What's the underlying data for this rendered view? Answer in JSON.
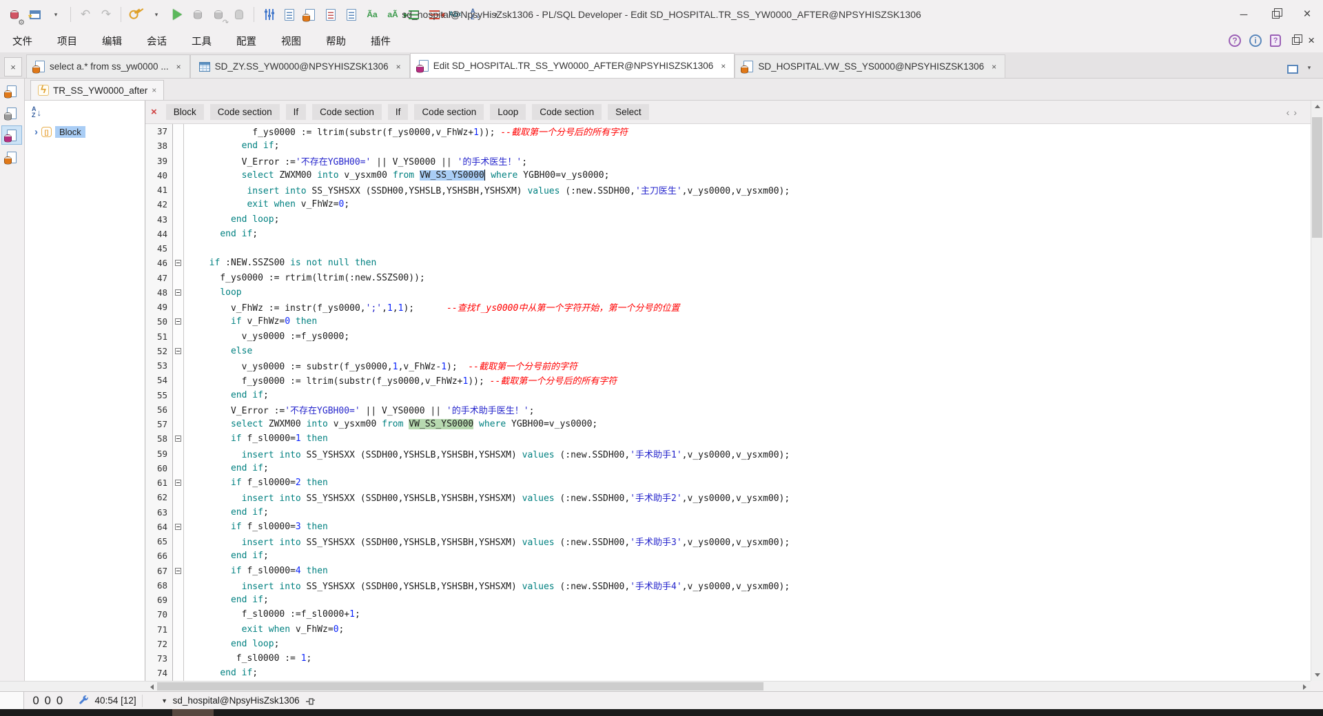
{
  "title_bar": {
    "title": "sd_hospital@NpsyHisZsk1306 - PL/SQL Developer - Edit SD_HOSPITAL.TR_SS_YW0000_AFTER@NPSYHISZSK1306"
  },
  "toolbar": {
    "icons": [
      "db-gear",
      "new-window",
      "caret",
      "sep",
      "undo",
      "redo",
      "sep",
      "key",
      "caret",
      "run",
      "commit",
      "rollback",
      "break",
      "sep",
      "preferences",
      "report-doc",
      "sql-doc",
      "doc-red",
      "doc-blue",
      "lowercase",
      "uppercase",
      "indent",
      "unindent",
      "special-chars",
      "sort-az",
      "caret"
    ]
  },
  "menu_bar": {
    "items": [
      "文件",
      "项目",
      "编辑",
      "会话",
      "工具",
      "配置",
      "视图",
      "帮助",
      "插件"
    ]
  },
  "tab_bar": {
    "tabs": [
      {
        "label": "select a.* from ss_yw0000 ...",
        "icon": "sql-doc-orange",
        "active": false
      },
      {
        "label": "SD_ZY.SS_YW0000@NPSYHISZSK1306",
        "icon": "table",
        "active": false
      },
      {
        "label": "Edit SD_HOSPITAL.TR_SS_YW0000_AFTER@NPSYHISZSK1306",
        "icon": "doc-magenta",
        "active": true
      },
      {
        "label": "SD_HOSPITAL.VW_SS_YS0000@NPSYHISZSK1306",
        "icon": "sql-doc-orange",
        "active": false
      }
    ]
  },
  "left_strip": {
    "icons": [
      {
        "name": "sql-window-icon",
        "color": "orange",
        "selected": false
      },
      {
        "name": "command-window-icon",
        "color": "gray",
        "selected": false
      },
      {
        "name": "trigger-window-icon",
        "color": "magenta",
        "selected": true
      },
      {
        "name": "view-window-icon",
        "color": "orange",
        "selected": false
      }
    ]
  },
  "sub_tab": {
    "label": "TR_SS_YW0000_after"
  },
  "breadcrumb": {
    "items": [
      "Block",
      "Code section",
      "If",
      "Code section",
      "If",
      "Code section",
      "Loop",
      "Code section",
      "Select"
    ]
  },
  "tree": {
    "root_label": "Block"
  },
  "colors": {
    "keyword": "#008080",
    "string": "#2626cc",
    "number": "#0b24fb",
    "comment": "#ff0000",
    "selection_blue": "#a9cdf5",
    "selection_green": "#b7d9b0"
  },
  "editor": {
    "lines": [
      {
        "n": 37,
        "f": 0,
        "s": [
          [
            "p",
            "          f_ys0000 := ltrim(substr(f_ys0000,v_FhWz+"
          ],
          [
            "n",
            "1"
          ],
          [
            "p",
            ")); "
          ],
          [
            "c",
            "--截取第一个分号后的所有字符"
          ]
        ]
      },
      {
        "n": 38,
        "f": 0,
        "s": [
          [
            "p",
            "        "
          ],
          [
            "k",
            "end if"
          ],
          [
            "p",
            ";"
          ]
        ]
      },
      {
        "n": 39,
        "f": 0,
        "s": [
          [
            "p",
            "        V_Error :="
          ],
          [
            "s",
            "'不存在YGBH00='"
          ],
          [
            "p",
            " || V_YS0000 || "
          ],
          [
            "s",
            "'的手术医生！'"
          ],
          [
            "p",
            ";"
          ]
        ]
      },
      {
        "n": 40,
        "f": 0,
        "s": [
          [
            "p",
            "        "
          ],
          [
            "k",
            "select"
          ],
          [
            "p",
            " ZWXM00 "
          ],
          [
            "k",
            "into"
          ],
          [
            "p",
            " v_ysxm00 "
          ],
          [
            "k",
            "from"
          ],
          [
            "p",
            " "
          ],
          [
            "sb",
            "VW_SS_YS0000"
          ],
          [
            "cur",
            ""
          ],
          [
            "p",
            " "
          ],
          [
            "k",
            "where"
          ],
          [
            "p",
            " YGBH00=v_ys0000;"
          ]
        ]
      },
      {
        "n": 41,
        "f": 0,
        "s": [
          [
            "p",
            "         "
          ],
          [
            "k",
            "insert"
          ],
          [
            "p",
            " "
          ],
          [
            "k",
            "into"
          ],
          [
            "p",
            " SS_YSHSXX (SSDH00,YSHSLB,YSHSBH,YSHSXM) "
          ],
          [
            "k",
            "values"
          ],
          [
            "p",
            " (:new.SSDH00,"
          ],
          [
            "s",
            "'主刀医生'"
          ],
          [
            "p",
            ",v_ys0000,v_ysxm00);"
          ]
        ]
      },
      {
        "n": 42,
        "f": 0,
        "s": [
          [
            "p",
            "         "
          ],
          [
            "k",
            "exit"
          ],
          [
            "p",
            " "
          ],
          [
            "k",
            "when"
          ],
          [
            "p",
            " v_FhWz="
          ],
          [
            "n",
            "0"
          ],
          [
            "p",
            ";"
          ]
        ]
      },
      {
        "n": 43,
        "f": 0,
        "s": [
          [
            "p",
            "      "
          ],
          [
            "k",
            "end loop"
          ],
          [
            "p",
            ";"
          ]
        ]
      },
      {
        "n": 44,
        "f": 0,
        "s": [
          [
            "p",
            "    "
          ],
          [
            "k",
            "end if"
          ],
          [
            "p",
            ";"
          ]
        ]
      },
      {
        "n": 45,
        "f": 0,
        "s": []
      },
      {
        "n": 46,
        "f": 1,
        "s": [
          [
            "p",
            "  "
          ],
          [
            "k",
            "if"
          ],
          [
            "p",
            " :NEW.SSZS00 "
          ],
          [
            "k",
            "is not null then"
          ]
        ]
      },
      {
        "n": 47,
        "f": 0,
        "s": [
          [
            "p",
            "    f_ys0000 := rtrim(ltrim(:new.SSZS00));"
          ]
        ]
      },
      {
        "n": 48,
        "f": 1,
        "s": [
          [
            "p",
            "    "
          ],
          [
            "k",
            "loop"
          ]
        ]
      },
      {
        "n": 49,
        "f": 0,
        "s": [
          [
            "p",
            "      v_FhWz := instr(f_ys0000,"
          ],
          [
            "s",
            "';'"
          ],
          [
            "p",
            ","
          ],
          [
            "n",
            "1"
          ],
          [
            "p",
            ","
          ],
          [
            "n",
            "1"
          ],
          [
            "p",
            ");      "
          ],
          [
            "c",
            "--查找f_ys0000中从第一个字符开始，第一个分号的位置"
          ]
        ]
      },
      {
        "n": 50,
        "f": 1,
        "s": [
          [
            "p",
            "      "
          ],
          [
            "k",
            "if"
          ],
          [
            "p",
            " v_FhWz="
          ],
          [
            "n",
            "0"
          ],
          [
            "p",
            " "
          ],
          [
            "k",
            "then"
          ]
        ]
      },
      {
        "n": 51,
        "f": 0,
        "s": [
          [
            "p",
            "        v_ys0000 :=f_ys0000;"
          ]
        ]
      },
      {
        "n": 52,
        "f": 1,
        "s": [
          [
            "p",
            "      "
          ],
          [
            "k",
            "else"
          ]
        ]
      },
      {
        "n": 53,
        "f": 0,
        "s": [
          [
            "p",
            "        v_ys0000 := substr(f_ys0000,"
          ],
          [
            "n",
            "1"
          ],
          [
            "p",
            ",v_FhWz-"
          ],
          [
            "n",
            "1"
          ],
          [
            "p",
            ");  "
          ],
          [
            "c",
            "--截取第一个分号前的字符"
          ]
        ]
      },
      {
        "n": 54,
        "f": 0,
        "s": [
          [
            "p",
            "        f_ys0000 := ltrim(substr(f_ys0000,v_FhWz+"
          ],
          [
            "n",
            "1"
          ],
          [
            "p",
            ")); "
          ],
          [
            "c",
            "--截取第一个分号后的所有字符"
          ]
        ]
      },
      {
        "n": 55,
        "f": 0,
        "s": [
          [
            "p",
            "      "
          ],
          [
            "k",
            "end if"
          ],
          [
            "p",
            ";"
          ]
        ]
      },
      {
        "n": 56,
        "f": 0,
        "s": [
          [
            "p",
            "      V_Error :="
          ],
          [
            "s",
            "'不存在YGBH00='"
          ],
          [
            "p",
            " || V_YS0000 || "
          ],
          [
            "s",
            "'的手术助手医生！'"
          ],
          [
            "p",
            ";"
          ]
        ]
      },
      {
        "n": 57,
        "f": 0,
        "s": [
          [
            "p",
            "      "
          ],
          [
            "k",
            "select"
          ],
          [
            "p",
            " ZWXM00 "
          ],
          [
            "k",
            "into"
          ],
          [
            "p",
            " v_ysxm00 "
          ],
          [
            "k",
            "from"
          ],
          [
            "p",
            " "
          ],
          [
            "sg",
            "VW_SS_YS0000"
          ],
          [
            "p",
            " "
          ],
          [
            "k",
            "where"
          ],
          [
            "p",
            " YGBH00=v_ys0000;"
          ]
        ]
      },
      {
        "n": 58,
        "f": 1,
        "s": [
          [
            "p",
            "      "
          ],
          [
            "k",
            "if"
          ],
          [
            "p",
            " f_sl0000="
          ],
          [
            "n",
            "1"
          ],
          [
            "p",
            " "
          ],
          [
            "k",
            "then"
          ]
        ]
      },
      {
        "n": 59,
        "f": 0,
        "s": [
          [
            "p",
            "        "
          ],
          [
            "k",
            "insert"
          ],
          [
            "p",
            " "
          ],
          [
            "k",
            "into"
          ],
          [
            "p",
            " SS_YSHSXX (SSDH00,YSHSLB,YSHSBH,YSHSXM) "
          ],
          [
            "k",
            "values"
          ],
          [
            "p",
            " (:new.SSDH00,"
          ],
          [
            "s",
            "'手术助手1'"
          ],
          [
            "p",
            ",v_ys0000,v_ysxm00);"
          ]
        ]
      },
      {
        "n": 60,
        "f": 0,
        "s": [
          [
            "p",
            "      "
          ],
          [
            "k",
            "end if"
          ],
          [
            "p",
            ";"
          ]
        ]
      },
      {
        "n": 61,
        "f": 1,
        "s": [
          [
            "p",
            "      "
          ],
          [
            "k",
            "if"
          ],
          [
            "p",
            " f_sl0000="
          ],
          [
            "n",
            "2"
          ],
          [
            "p",
            " "
          ],
          [
            "k",
            "then"
          ]
        ]
      },
      {
        "n": 62,
        "f": 0,
        "s": [
          [
            "p",
            "        "
          ],
          [
            "k",
            "insert"
          ],
          [
            "p",
            " "
          ],
          [
            "k",
            "into"
          ],
          [
            "p",
            " SS_YSHSXX (SSDH00,YSHSLB,YSHSBH,YSHSXM) "
          ],
          [
            "k",
            "values"
          ],
          [
            "p",
            " (:new.SSDH00,"
          ],
          [
            "s",
            "'手术助手2'"
          ],
          [
            "p",
            ",v_ys0000,v_ysxm00);"
          ]
        ]
      },
      {
        "n": 63,
        "f": 0,
        "s": [
          [
            "p",
            "      "
          ],
          [
            "k",
            "end if"
          ],
          [
            "p",
            ";"
          ]
        ]
      },
      {
        "n": 64,
        "f": 1,
        "s": [
          [
            "p",
            "      "
          ],
          [
            "k",
            "if"
          ],
          [
            "p",
            " f_sl0000="
          ],
          [
            "n",
            "3"
          ],
          [
            "p",
            " "
          ],
          [
            "k",
            "then"
          ]
        ]
      },
      {
        "n": 65,
        "f": 0,
        "s": [
          [
            "p",
            "        "
          ],
          [
            "k",
            "insert"
          ],
          [
            "p",
            " "
          ],
          [
            "k",
            "into"
          ],
          [
            "p",
            " SS_YSHSXX (SSDH00,YSHSLB,YSHSBH,YSHSXM) "
          ],
          [
            "k",
            "values"
          ],
          [
            "p",
            " (:new.SSDH00,"
          ],
          [
            "s",
            "'手术助手3'"
          ],
          [
            "p",
            ",v_ys0000,v_ysxm00);"
          ]
        ]
      },
      {
        "n": 66,
        "f": 0,
        "s": [
          [
            "p",
            "      "
          ],
          [
            "k",
            "end if"
          ],
          [
            "p",
            ";"
          ]
        ]
      },
      {
        "n": 67,
        "f": 1,
        "s": [
          [
            "p",
            "      "
          ],
          [
            "k",
            "if"
          ],
          [
            "p",
            " f_sl0000="
          ],
          [
            "n",
            "4"
          ],
          [
            "p",
            " "
          ],
          [
            "k",
            "then"
          ]
        ]
      },
      {
        "n": 68,
        "f": 0,
        "s": [
          [
            "p",
            "        "
          ],
          [
            "k",
            "insert"
          ],
          [
            "p",
            " "
          ],
          [
            "k",
            "into"
          ],
          [
            "p",
            " SS_YSHSXX (SSDH00,YSHSLB,YSHSBH,YSHSXM) "
          ],
          [
            "k",
            "values"
          ],
          [
            "p",
            " (:new.SSDH00,"
          ],
          [
            "s",
            "'手术助手4'"
          ],
          [
            "p",
            ",v_ys0000,v_ysxm00);"
          ]
        ]
      },
      {
        "n": 69,
        "f": 0,
        "s": [
          [
            "p",
            "      "
          ],
          [
            "k",
            "end if"
          ],
          [
            "p",
            ";"
          ]
        ]
      },
      {
        "n": 70,
        "f": 0,
        "s": [
          [
            "p",
            "        f_sl0000 :=f_sl0000+"
          ],
          [
            "n",
            "1"
          ],
          [
            "p",
            ";"
          ]
        ]
      },
      {
        "n": 71,
        "f": 0,
        "s": [
          [
            "p",
            "        "
          ],
          [
            "k",
            "exit"
          ],
          [
            "p",
            " "
          ],
          [
            "k",
            "when"
          ],
          [
            "p",
            " v_FhWz="
          ],
          [
            "n",
            "0"
          ],
          [
            "p",
            ";"
          ]
        ]
      },
      {
        "n": 72,
        "f": 0,
        "s": [
          [
            "p",
            "      "
          ],
          [
            "k",
            "end loop"
          ],
          [
            "p",
            ";"
          ]
        ]
      },
      {
        "n": 73,
        "f": 0,
        "s": [
          [
            "p",
            "       f_sl0000 := "
          ],
          [
            "n",
            "1"
          ],
          [
            "p",
            ";"
          ]
        ]
      },
      {
        "n": 74,
        "f": 0,
        "s": [
          [
            "p",
            "    "
          ],
          [
            "k",
            "end if"
          ],
          [
            "p",
            ";"
          ]
        ]
      }
    ]
  },
  "status_bar": {
    "counters": "000",
    "position": "40:54 [12]",
    "connection": "sd_hospital@NpsyHisZsk1306"
  }
}
